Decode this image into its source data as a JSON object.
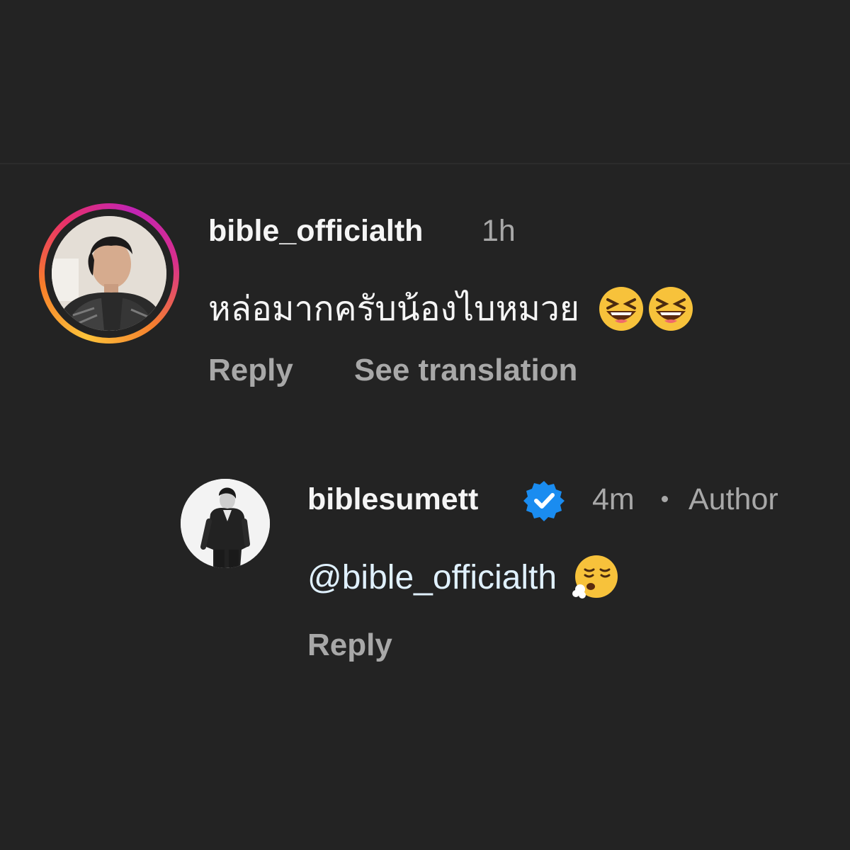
{
  "comments": [
    {
      "username": "bible_officialth",
      "time": "1h",
      "text": "หล่อมากครับน้องไบหมวย",
      "emojis": [
        "grinning-squinting-face",
        "grinning-squinting-face"
      ],
      "actions": {
        "reply": "Reply",
        "translate": "See translation"
      },
      "avatar_ring": true
    },
    {
      "username": "biblesumett",
      "verified": true,
      "time": "4m",
      "separator": "•",
      "badge": "Author",
      "mention": "@bible_officialth",
      "emojis": [
        "face-exhaling"
      ],
      "actions": {
        "reply": "Reply"
      }
    }
  ],
  "colors": {
    "background": "#232323",
    "primary_text": "#f5f5f5",
    "secondary_text": "#a8a8a8",
    "mention": "#e0f1ff",
    "verified": "#1a8cf0"
  }
}
